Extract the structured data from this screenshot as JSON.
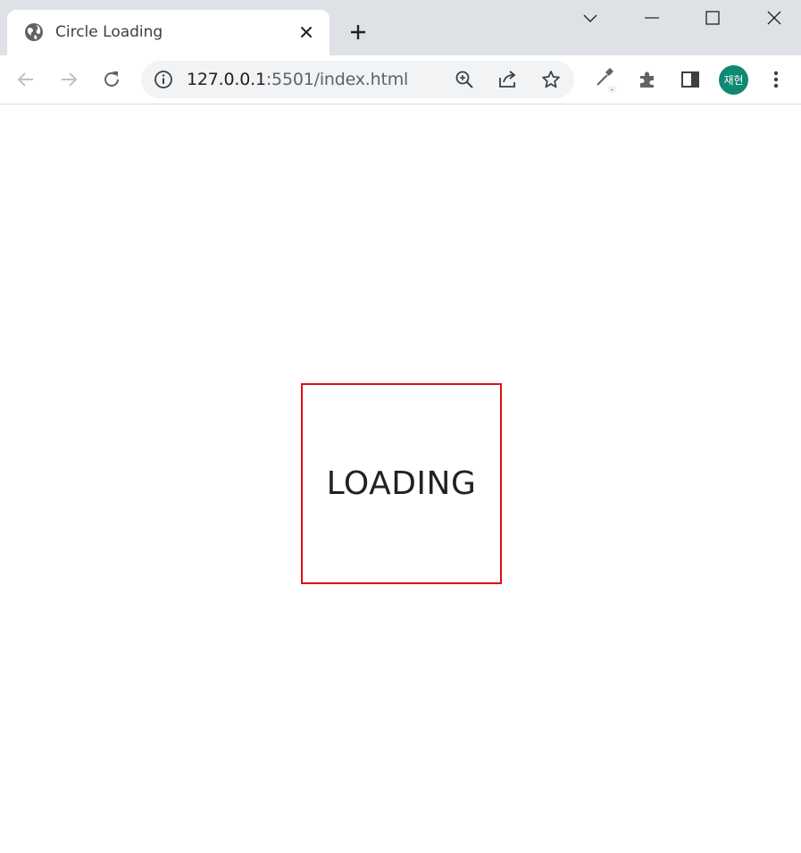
{
  "browser": {
    "tab": {
      "title": "Circle Loading",
      "favicon": "globe-icon"
    },
    "address": {
      "host": "127.0.0.1",
      "path": ":5501/index.html"
    },
    "profile": {
      "initials": "재현",
      "color": "#0f8a72"
    }
  },
  "page": {
    "loader_text": "LOADING",
    "border_color": "#e00f0f"
  }
}
